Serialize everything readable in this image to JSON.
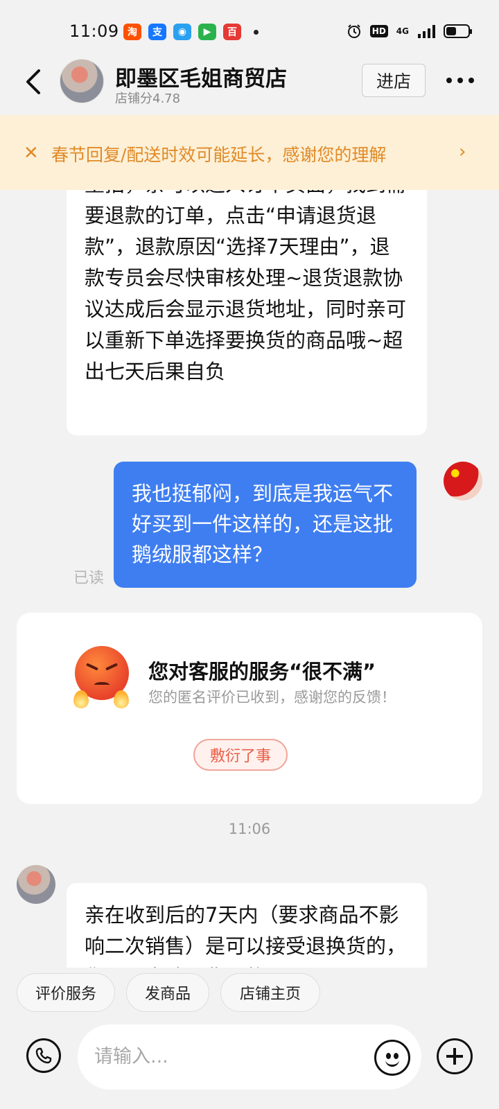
{
  "status_bar": {
    "time": "11:09",
    "apps": [
      {
        "icon": "taobao-app-icon",
        "glyph": "淘",
        "color": "#ff5000"
      },
      {
        "icon": "alipay-app-icon",
        "glyph": "支",
        "color": "#1677ff"
      },
      {
        "icon": "circle-app-icon",
        "glyph": "◉",
        "color": "#2aa0f0"
      },
      {
        "icon": "video-app-icon",
        "glyph": "▶",
        "color": "#2bb24c"
      },
      {
        "icon": "baiyi-app-icon",
        "glyph": "百",
        "color": "#e53935"
      }
    ],
    "hd": "HD",
    "network": "4G"
  },
  "header": {
    "shop_name": "即墨区毛姐商贸店",
    "shop_score": "店铺分4.78",
    "enter_shop": "进店"
  },
  "notice": {
    "text": "春节回复/配送时效可能延长，感谢您的理解"
  },
  "messages": {
    "shop_msg_1": "重拍，亲可以进入订单页面，找到需要退款的订单，点击“申请退货退款”，退款原因“选择7天理由”，退款专员会尽快审核处理~退货退款协议达成后会显示退货地址，同时亲可以重新下单选择要换货的商品哦~超出七天后果自负",
    "user_msg": "我也挺郁闷，到底是我运气不好买到一件这样的，还是这批鹅绒服都这样？",
    "read_status": "已读",
    "evaluation": {
      "title": "您对客服的服务“很不满”",
      "subtitle": "您的匿名评价已收到，感谢您的反馈！",
      "tag": "敷衍了事"
    },
    "timestamp": "11:06",
    "shop_msg_2": "亲在收到后的7天内（要求商品不影响二次销售）是可以接受退换货的，您可以申请退货退款"
  },
  "quick_actions": [
    "评价服务",
    "发商品",
    "店铺主页"
  ],
  "input": {
    "placeholder": "请输入..."
  }
}
